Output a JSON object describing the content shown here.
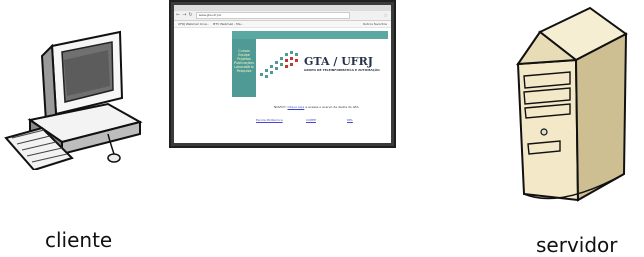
{
  "diagram": {
    "client_label": "cliente",
    "server_label": "servidor"
  },
  "browser": {
    "url": "www.gta.ufrj.br",
    "bookmarks": [
      "UFRJ Webmail Icnw...",
      "BTV Webmail - Ma..."
    ],
    "other_bookmarks": "Outros favoritos",
    "site": {
      "menu": [
        "Cursos",
        "Equipe",
        "Projetos",
        "Publicações",
        "Laboratório",
        "Pesquisa"
      ],
      "logo_title": "GTA / UFRJ",
      "logo_subtitle": "GRUPO DE TELEINFORMÁTICA E AUTOMAÇÃO",
      "welcome_prefix": "NOVO!!!",
      "welcome_link": "Clique aqui",
      "welcome_suffix": "e acesse o acervo de dados do GTA.",
      "footer_links": [
        "Escola Politécnica",
        "COPPE",
        "DEL"
      ]
    }
  }
}
